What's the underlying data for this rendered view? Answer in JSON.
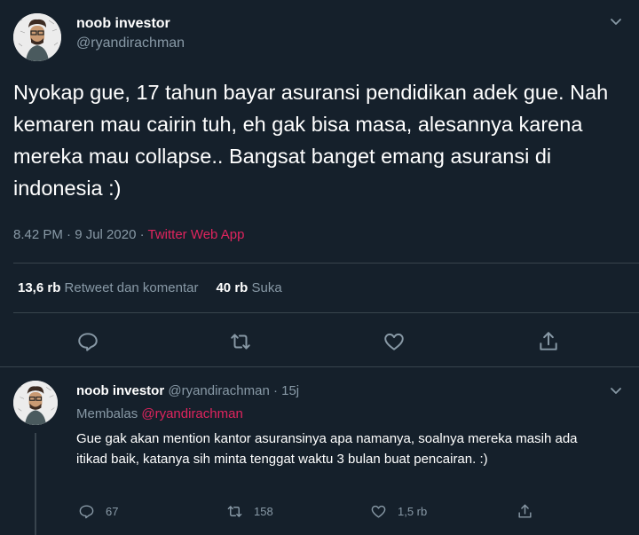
{
  "main_tweet": {
    "display_name": "noob investor",
    "handle": "@ryandirachman",
    "text": "Nyokap gue, 17 tahun bayar asuransi pendidikan adek gue. Nah kemaren mau cairin tuh, eh gak bisa masa, alesannya karena mereka mau collapse.. Bangsat banget emang asuransi di indonesia :)",
    "time_date": "8.42 PM · 9 Jul 2020 · ",
    "source_app": "Twitter Web App",
    "retweets_count": "13,6 rb",
    "retweets_label": "Retweet dan komentar",
    "likes_count": "40 rb",
    "likes_label": "Suka"
  },
  "reply_tweet": {
    "display_name": "noob investor",
    "handle_time": "@ryandirachman · 15j",
    "replying_prefix": "Membalas ",
    "replying_to": "@ryandirachman",
    "text": "Gue gak akan mention kantor asuransinya apa namanya, soalnya mereka masih ada itikad baik, katanya sih minta tenggat waktu 3 bulan buat pencairan. :)",
    "reply_count": "67",
    "retweet_count": "158",
    "like_count": "1,5 rb"
  },
  "icons": {
    "reply": "comment-icon",
    "retweet": "retweet-icon",
    "like": "heart-icon",
    "share": "share-icon",
    "menu": "chevron-down-icon"
  },
  "colors": {
    "background": "#15202b",
    "secondary_text": "#8899a6",
    "accent": "#e0245e",
    "divider": "#38444d"
  }
}
